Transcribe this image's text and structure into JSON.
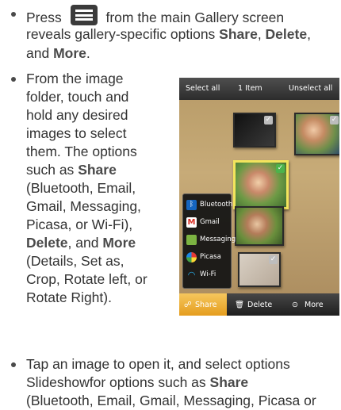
{
  "bullets": {
    "b1": {
      "line1_pre": "Press",
      "line1_post": "from the main Gallery screen",
      "line2_pre": "reveals gallery-specific options ",
      "line2_share": "Share",
      "line2_sep": ", ",
      "line2_delete": "Delete",
      "line2_end": ",",
      "line3_pre": "and ",
      "line3_more": "More",
      "line3_end": "."
    },
    "b2": {
      "lines": [
        "From the image",
        "folder, touch and",
        "hold any desired",
        "images to select",
        "them. The options",
        "such as ",
        "(Bluetooth, Email,",
        "Gmail, Messaging,",
        "Picasa, or Wi-Fi),",
        "",
        "(Details, Set as,",
        "Crop, Rotate left, or",
        "Rotate Right)."
      ],
      "share": "Share",
      "delete": "Delete",
      "and": ", and ",
      "more": "More"
    },
    "b3": {
      "line1": "Tap an image to open it, and select options",
      "line2_pre": "Slideshowfor options such as ",
      "line2_share": "Share",
      "line3": "(Bluetooth, Email, Gmail, Messaging, Picasa or"
    }
  },
  "phone": {
    "topbar": {
      "select_all": "Select all",
      "count": "1 Item",
      "unselect_all": "Unselect all"
    },
    "share_menu": [
      {
        "label": "Bluetooth",
        "icon": "bluetooth-icon",
        "color": "#1565c0"
      },
      {
        "label": "Gmail",
        "icon": "gmail-icon",
        "color": "#d93025"
      },
      {
        "label": "Messaging",
        "icon": "messaging-icon",
        "color": "#7cb342"
      },
      {
        "label": "Picasa",
        "icon": "picasa-icon",
        "color": "#ef6c00"
      },
      {
        "label": "Wi-Fi",
        "icon": "wifi-icon",
        "color": "#29b6f6"
      }
    ],
    "bottombar": {
      "share": "Share",
      "delete": "Delete",
      "more": "More"
    }
  }
}
